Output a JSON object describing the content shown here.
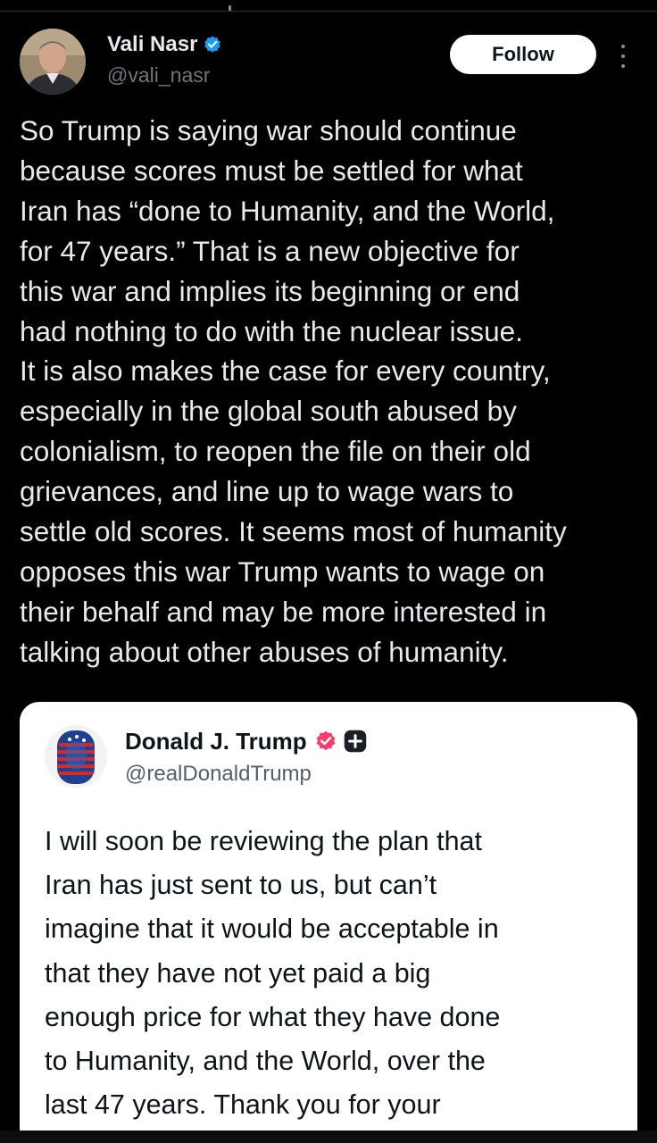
{
  "tweet": {
    "author_name": "Vali Nasr",
    "author_handle": "@vali_nasr",
    "follow_label": "Follow",
    "text": "So Trump is saying war should continue\nbecause scores must be settled for what\nIran has “done to Humanity, and the World,\nfor 47 years.” That is a new objective for\nthis war and implies its beginning or end\nhad nothing to do with the nuclear issue.\nIt is also makes the case for every country,\nespecially in the global south abused by\ncolonialism, to reopen the file on their old\ngrievances, and line up to wage wars to\nsettle old scores. It seems most of humanity\nopposes this war Trump wants to wage on\ntheir behalf and may be more interested in\ntalking about other abuses of humanity.",
    "verified_icon": "verified-badge-icon",
    "colors": {
      "background": "#000000",
      "text": "#e7e9ea",
      "handle": "#71767b",
      "verified": "#1d9bf0"
    }
  },
  "quoted_post": {
    "author_name": "Donald J. Trump",
    "author_handle": "@realDonaldTrump",
    "text": "I will soon be reviewing the plan that\nIran has just sent to us, but can’t\nimagine that it would be acceptable in\nthat they have not yet paid a big\nenough price for what they have done\nto Humanity, and the World, over the\nlast 47 years. Thank you for your",
    "badge_icon": "verified-badge-icon",
    "extra_icon": "plus-badge-icon",
    "colors": {
      "card_background": "#ffffff",
      "text": "#0f1419",
      "badge": "#f4406f"
    }
  }
}
